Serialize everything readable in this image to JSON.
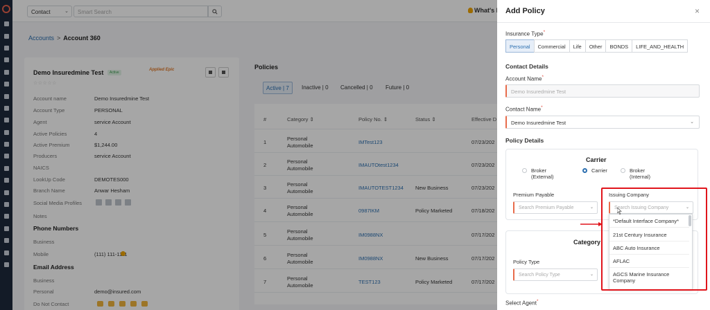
{
  "topbar": {
    "contact_type": "Contact",
    "search_placeholder": "Smart Search",
    "whats_new": "What's N"
  },
  "breadcrumb": {
    "accounts": "Accounts",
    "sep": ">",
    "current": "Account 360"
  },
  "account": {
    "name": "Demo Insuredmine Test",
    "status": "Active",
    "partner_logo": "Applied Epic",
    "stars": "☆☆☆☆☆",
    "details": [
      {
        "label": "Account name",
        "value": "Demo Insuredmine Test"
      },
      {
        "label": "Account Type",
        "value": "PERSONAL"
      },
      {
        "label": "Agent",
        "value": "service Account"
      },
      {
        "label": "Active Policies",
        "value": "4"
      },
      {
        "label": "Active Premium",
        "value": "$1,244.00"
      },
      {
        "label": "Producers",
        "value": "service Account"
      },
      {
        "label": "NAICS",
        "value": ""
      },
      {
        "label": "LookUp Code",
        "value": "DEMOTES000"
      },
      {
        "label": "Branch Name",
        "value": "Anwar Hesham"
      },
      {
        "label": "Social Media Profiles",
        "value": ""
      },
      {
        "label": "Notes",
        "value": ""
      }
    ],
    "phone_heading": "Phone Numbers",
    "phone": [
      {
        "label": "Business",
        "value": ""
      },
      {
        "label": "Mobile",
        "value": "(111) 111-1111"
      }
    ],
    "email_heading": "Email Address",
    "email": [
      {
        "label": "Business",
        "value": ""
      },
      {
        "label": "Personal",
        "value": "demo@insured.com"
      }
    ],
    "dnc_label": "Do Not Contact"
  },
  "policies": {
    "title": "Policies",
    "tabs": [
      {
        "label": "Active",
        "count": "7"
      },
      {
        "label": "Inactive",
        "count": "0"
      },
      {
        "label": "Cancelled",
        "count": "0"
      },
      {
        "label": "Future",
        "count": "0"
      }
    ],
    "columns": [
      "#",
      "Category ⇕",
      "Policy No. ⇕",
      "Status ⇕",
      "Effective D"
    ],
    "rows": [
      {
        "n": "1",
        "cat1": "Personal",
        "cat2": "Automobile",
        "no": "IMTest123",
        "status": "",
        "eff": "07/23/202"
      },
      {
        "n": "2",
        "cat1": "Personal",
        "cat2": "Automobile",
        "no": "IMAUTOtest1234",
        "status": "",
        "eff": "07/23/202"
      },
      {
        "n": "3",
        "cat1": "Personal",
        "cat2": "Automobile",
        "no": "IMAUTOTEST1234",
        "status": "New Business",
        "eff": "07/23/202"
      },
      {
        "n": "4",
        "cat1": "Personal",
        "cat2": "Automobile",
        "no": "0987IKM",
        "status": "Policy Marketed",
        "eff": "07/18/202"
      },
      {
        "n": "5",
        "cat1": "Personal",
        "cat2": "Automobile",
        "no": "IM0988NX",
        "status": "",
        "eff": "07/17/202"
      },
      {
        "n": "6",
        "cat1": "Personal",
        "cat2": "Automobile",
        "no": "IM0988NX",
        "status": "New Business",
        "eff": "07/17/202"
      },
      {
        "n": "7",
        "cat1": "Personal",
        "cat2": "Automobile",
        "no": "TEST123",
        "status": "Policy Marketed",
        "eff": "07/17/202"
      }
    ]
  },
  "drawer": {
    "title": "Add Policy",
    "close": "×",
    "insurance_type_label": "Insurance Type",
    "insurance_types": [
      "Personal",
      "Commercial",
      "Life",
      "Other",
      "BONDS",
      "LIFE_AND_HEALTH"
    ],
    "contact_details": "Contact Details",
    "account_name_label": "Account Name",
    "account_name_value": "Demo Insuredmine Test",
    "contact_name_label": "Contact Name",
    "contact_name_value": "Demo Insuredmine Test",
    "policy_details": "Policy Details",
    "carrier_title": "Carrier",
    "carrier_options": [
      {
        "l1": "Broker",
        "l2": "(External)"
      },
      {
        "l1": "Carrier",
        "l2": ""
      },
      {
        "l1": "Broker",
        "l2": "(Internal)"
      }
    ],
    "premium_payable_label": "Premium Payable",
    "premium_payable_placeholder": "Search Premium Payable",
    "issuing_company_label": "Issuing Company",
    "issuing_company_placeholder": "Search Issuing Company",
    "category_title": "Category",
    "policy_type_label": "Policy Type",
    "policy_type_placeholder": "Search Policy Type",
    "select_agent_label": "Select Agent",
    "dropdown_options": [
      {
        "l1": "*Default Interface Company*",
        "l2": ""
      },
      {
        "l1": "21st Century Insurance",
        "l2": ""
      },
      {
        "l1": "ABC Auto Insurance",
        "l2": ""
      },
      {
        "l1": "AFLAC",
        "l2": ""
      },
      {
        "l1": "AGCS Marine Insurance",
        "l2": "Company"
      }
    ]
  },
  "colors": {
    "accent": "#2c6fb0",
    "highlight": "#e0141b",
    "required": "#e24a3b",
    "rail": "#1e2a3c"
  }
}
